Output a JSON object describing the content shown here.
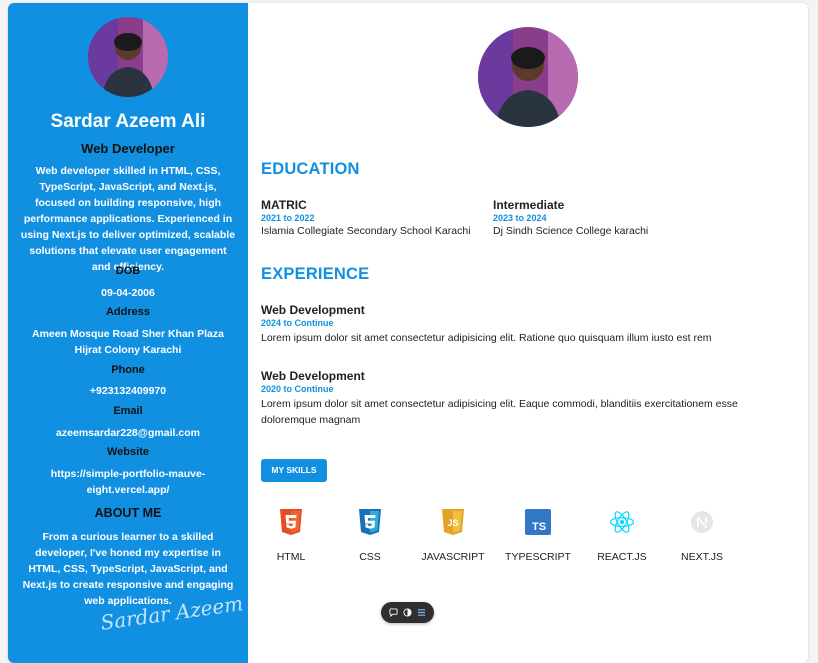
{
  "profile": {
    "name": "Sardar Azeem Ali",
    "role": "Web Developer",
    "bio": "Web developer skilled in HTML, CSS, TypeScript, JavaScript, and Next.js, focused on building responsive, high performance applications. Experienced in using Next.js to deliver optimized, scalable solutions that elevate user engagement and efficiency.",
    "dob_label": "DOB",
    "dob": "09-04-2006",
    "address_label": "Address",
    "address": "Ameen Mosque Road Sher Khan Plaza Hijrat Colony Karachi",
    "phone_label": "Phone",
    "phone": "+923132409970",
    "email_label": "Email",
    "email": "azeemsardar228@gmail.com",
    "website_label": "Website",
    "website": "https://simple-portfolio-mauve-eight.vercel.app/",
    "about_title": "ABOUT ME",
    "about": "From a curious learner to a skilled developer, I've honed my expertise in HTML, CSS, TypeScript, JavaScript, and Next.js to create responsive and engaging web applications.",
    "signature": "Sardar Azeem"
  },
  "education": {
    "title": "EDUCATION",
    "items": [
      {
        "title": "MATRIC",
        "date": "2021 to 2022",
        "school": "Islamia Collegiate Secondary School Karachi"
      },
      {
        "title": "Intermediate",
        "date": "2023 to 2024",
        "school": "Dj Sindh Science College karachi"
      }
    ]
  },
  "experience": {
    "title": "EXPERIENCE",
    "items": [
      {
        "title": "Web Development",
        "date": "2024 to Continue",
        "desc": "Lorem ipsum dolor sit amet consectetur adipisicing elit. Ratione quo quisquam illum iusto est rem"
      },
      {
        "title": "Web Development",
        "date": "2020 to Continue",
        "desc": "Lorem ipsum dolor sit amet consectetur adipisicing elit. Eaque commodi, blanditiis exercitationem esse doloremque magnam"
      }
    ]
  },
  "skills": {
    "button_label": "MY SKILLS",
    "items": [
      {
        "label": "HTML",
        "icon": "html5-icon",
        "color": "#e44d26"
      },
      {
        "label": "CSS",
        "icon": "css3-icon",
        "color": "#1572b6"
      },
      {
        "label": "JAVASCRIPT",
        "icon": "javascript-icon",
        "color": "#e5a228"
      },
      {
        "label": "TYPESCRIPT",
        "icon": "typescript-icon",
        "color": "#3178c6"
      },
      {
        "label": "REACT.JS",
        "icon": "react-icon",
        "color": "#00d8ff"
      },
      {
        "label": "NEXT.JS",
        "icon": "nextjs-icon",
        "color": "#d9d9d9"
      }
    ]
  },
  "colors": {
    "accent": "#1190e2",
    "sidebar": "#1190e2"
  }
}
